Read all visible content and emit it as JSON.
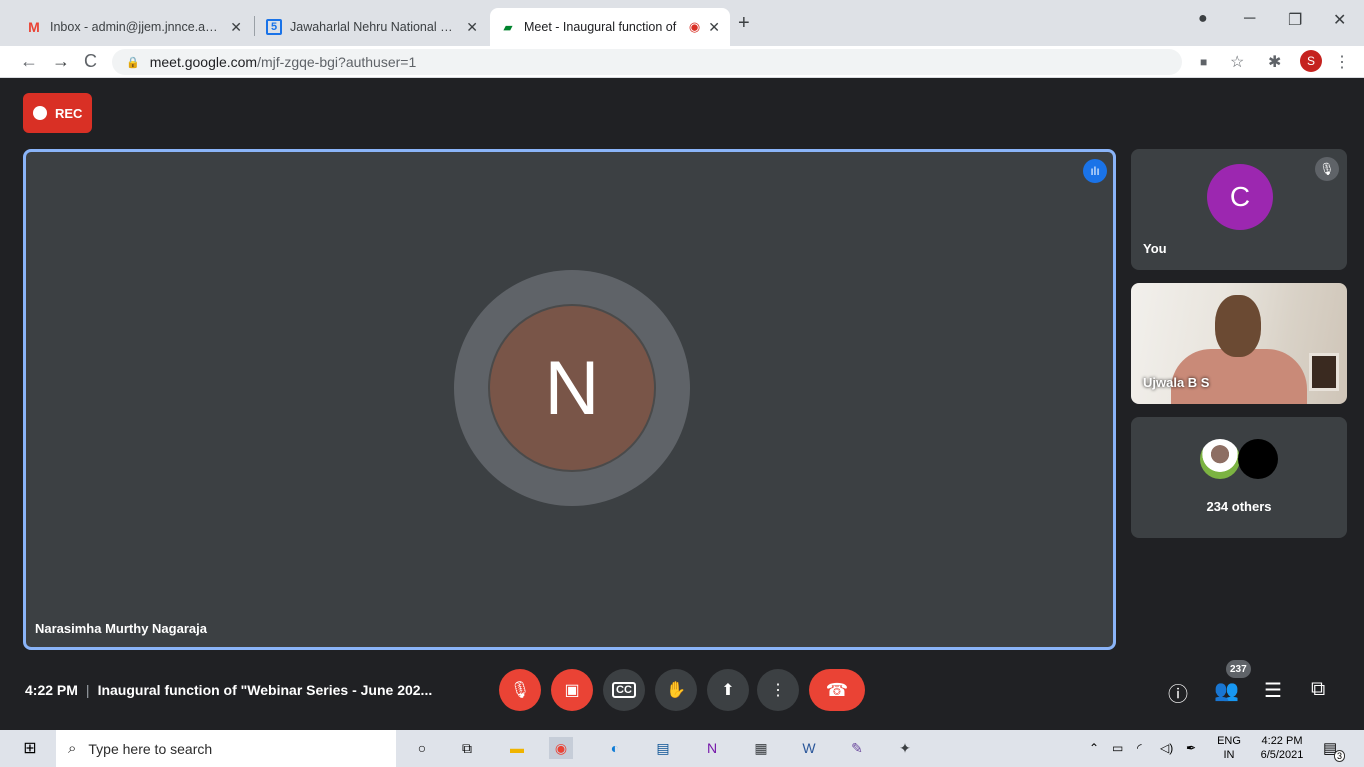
{
  "browser": {
    "tabs": [
      {
        "title": "Inbox - admin@jjem.jnnce.ac.in -",
        "icon": "gmail-icon"
      },
      {
        "title": "Jawaharlal Nehru National Colleg",
        "icon": "calendar-icon"
      },
      {
        "title": "Meet - Inaugural function of",
        "icon": "meet-icon",
        "active": true
      }
    ],
    "url_host": "meet.google.com",
    "url_path": "/mjf-zgqe-bgi?authuser=1",
    "profile_initial": "S"
  },
  "meet": {
    "rec_label": "REC",
    "main_tile": {
      "initial": "N",
      "name": "Narasimha Murthy Nagaraja"
    },
    "side_tiles": {
      "you": {
        "initial": "C",
        "label": "You"
      },
      "ujwala": {
        "label": "Ujwala B S"
      },
      "others": {
        "label": "234 others"
      }
    },
    "time": "4:22 PM",
    "meeting_title": "Inaugural function of \"Webinar Series - June 202...",
    "participants_count": "237"
  },
  "taskbar": {
    "search_placeholder": "Type here to search",
    "lang_top": "ENG",
    "lang_bottom": "IN",
    "clock_time": "4:22 PM",
    "clock_date": "6/5/2021",
    "notification_count": "3"
  },
  "colors": {
    "accent_blue": "#8ab4f8",
    "danger_red": "#ea4335",
    "avatar_purple": "#9c27b0",
    "avatar_brown": "#795548"
  }
}
